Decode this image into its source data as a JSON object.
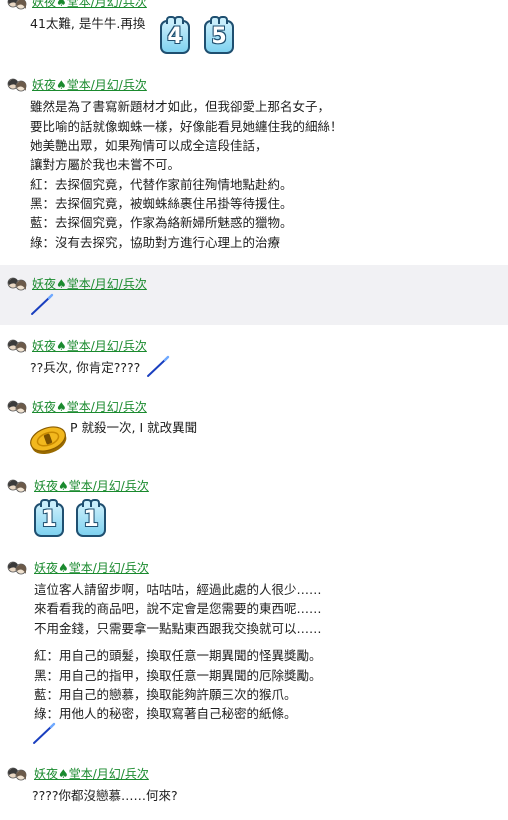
{
  "posts": [
    {
      "name": "妖夜♠堂本/月幻/兵次",
      "lines": [
        "41太難, 是牛牛.再換"
      ],
      "dice": [
        "4",
        "5"
      ]
    },
    {
      "name": "妖夜♠堂本/月幻/兵次",
      "lines": [
        "雖然是為了書寫新題材才如此，但我卻愛上那名女子，",
        "要比喻的話就像蜘蛛一樣，好像能看見她纏住我的細絲！",
        "她美艷出眾，如果殉情可以成全這段佳話，",
        "讓對方屬於我也未嘗不可。",
        "紅：去探個究竟，代替作家前往殉情地點赴約。",
        "黑：去探個究竟，被蜘蛛絲裹住吊掛等待援住。",
        "藍：去探個究竟，作家為絡新婦所魅惑的獵物。",
        "綠：沒有去探究，協助對方進行心理上的治療"
      ]
    },
    {
      "name": "妖夜♠堂本/月幻/兵次",
      "lines": []
    },
    {
      "name": "妖夜♠堂本/月幻/兵次",
      "lines": [
        "??兵次, 你肯定????"
      ]
    },
    {
      "name": "妖夜♠堂本/月幻/兵次",
      "lines": [
        "P 就殺一次, I 就改異聞"
      ]
    },
    {
      "name": "妖夜♠堂本/月幻/兵次",
      "lines": [],
      "dice": [
        "1",
        "1"
      ]
    },
    {
      "name": "妖夜♠堂本/月幻/兵次",
      "lines": [
        "這位客人請留步啊，咕咕咕，經過此處的人很少……",
        "來看看我的商品吧，說不定會是您需要的東西呢……",
        "不用金錢，只需要拿一點點東西跟我交換就可以……",
        "紅：用自己的頭髮，換取任意一期異聞的怪異獎勵。",
        "黑：用自己的指甲，換取任意一期異聞的厄除獎勵。",
        "藍：用自己的戀慕，換取能夠許願三次的猴爪。",
        "綠：用他人的秘密，換取寫著自己秘密的紙條。"
      ]
    },
    {
      "name": "妖夜♠堂本/月幻/兵次",
      "lines": [
        "????你都沒戀慕……何來?"
      ]
    }
  ],
  "icons": {
    "avatar": "avatar-icon",
    "cue": "billiard-cue-icon",
    "coin": "gold-coin-icon",
    "dice": "dice-number-tile"
  },
  "colors": {
    "name": "#1a8a2e",
    "highlight": "#f1f1f4",
    "tile_border": "#1f4f70"
  }
}
